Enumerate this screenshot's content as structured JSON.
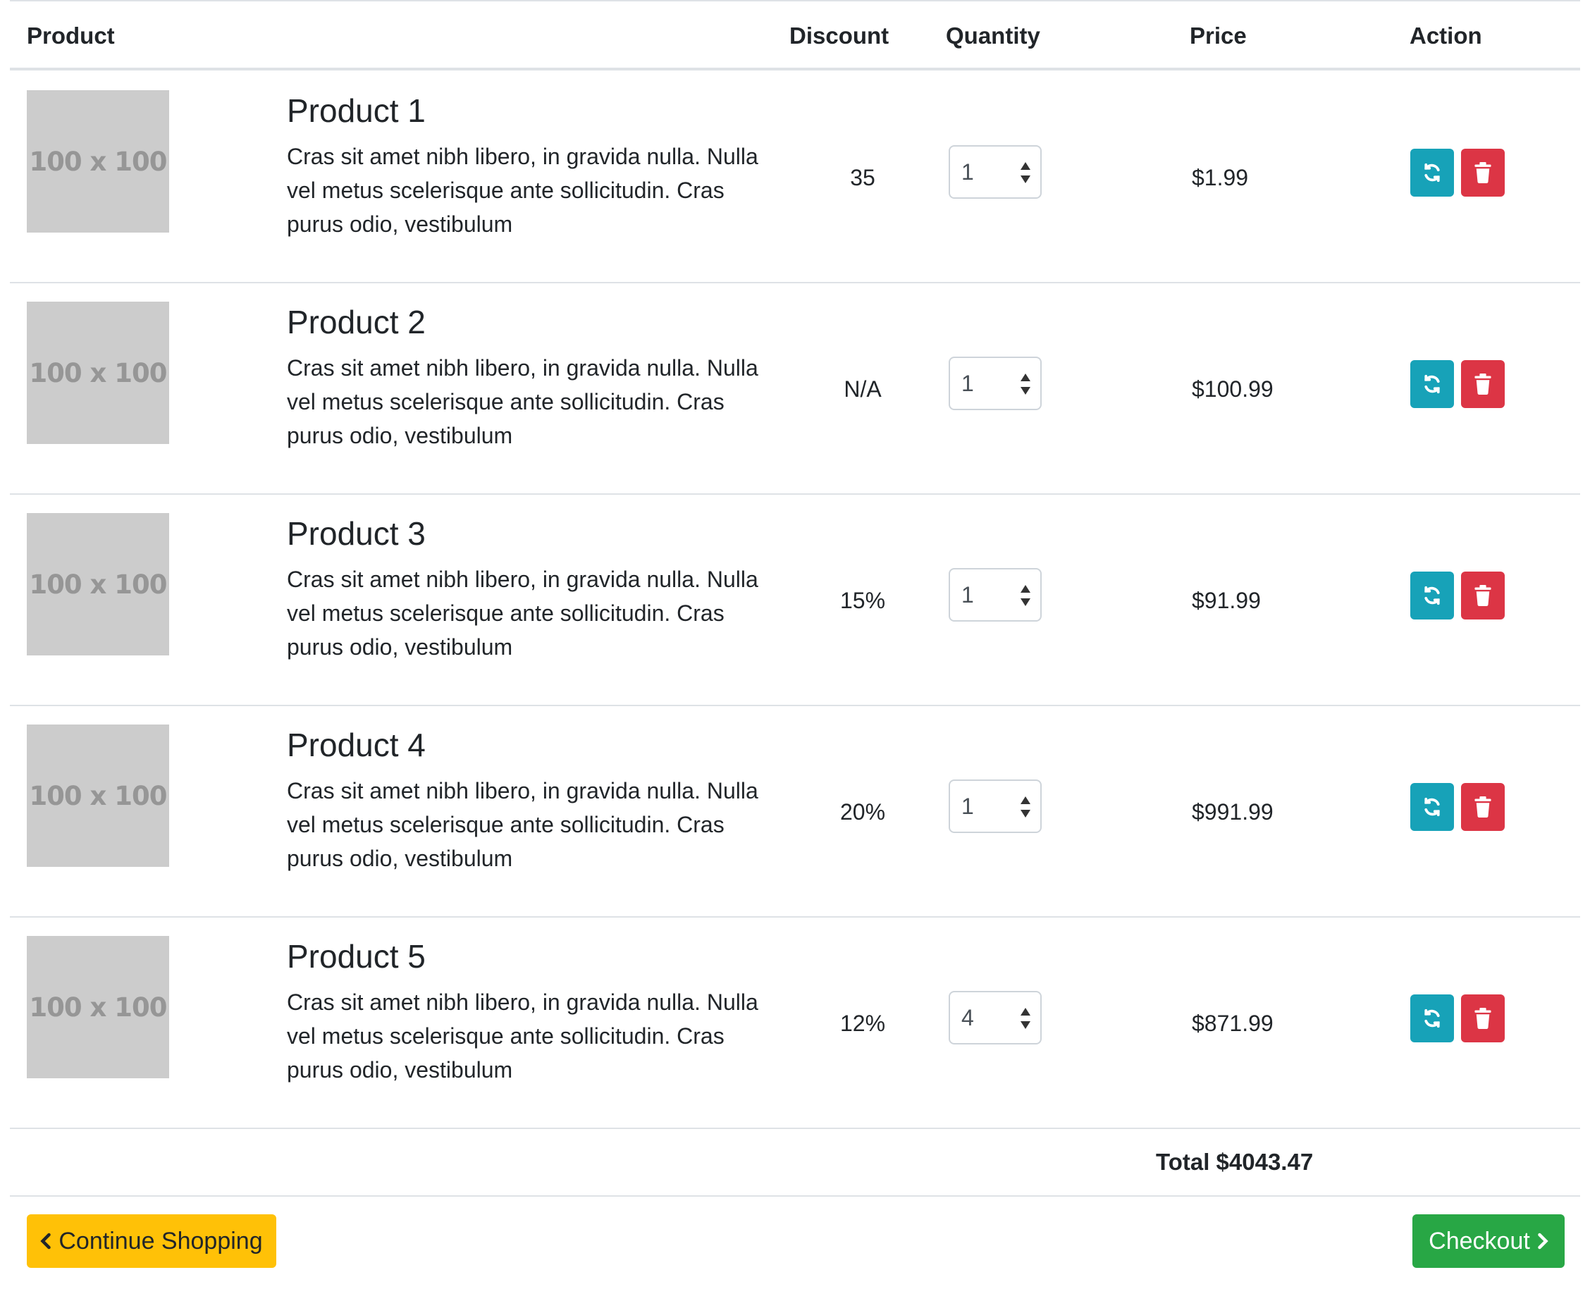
{
  "table": {
    "headers": {
      "product": "Product",
      "discount": "Discount",
      "quantity": "Quantity",
      "price": "Price",
      "action": "Action"
    },
    "rows": [
      {
        "thumb_text": "100 x 100",
        "name": "Product 1",
        "description": "Cras sit amet nibh libero, in gravida nulla. Nulla vel metus scelerisque ante sollicitudin. Cras purus odio, vestibulum",
        "discount": "35",
        "quantity": "1",
        "price": "$1.99"
      },
      {
        "thumb_text": "100 x 100",
        "name": "Product 2",
        "description": "Cras sit amet nibh libero, in gravida nulla. Nulla vel metus scelerisque ante sollicitudin. Cras purus odio, vestibulum",
        "discount": "N/A",
        "quantity": "1",
        "price": "$100.99"
      },
      {
        "thumb_text": "100 x 100",
        "name": "Product 3",
        "description": "Cras sit amet nibh libero, in gravida nulla. Nulla vel metus scelerisque ante sollicitudin. Cras purus odio, vestibulum",
        "discount": "15%",
        "quantity": "1",
        "price": "$91.99"
      },
      {
        "thumb_text": "100 x 100",
        "name": "Product 4",
        "description": "Cras sit amet nibh libero, in gravida nulla. Nulla vel metus scelerisque ante sollicitudin. Cras purus odio, vestibulum",
        "discount": "20%",
        "quantity": "1",
        "price": "$991.99"
      },
      {
        "thumb_text": "100 x 100",
        "name": "Product 5",
        "description": "Cras sit amet nibh libero, in gravida nulla. Nulla vel metus scelerisque ante sollicitudin. Cras purus odio, vestibulum",
        "discount": "12%",
        "quantity": "4",
        "price": "$871.99"
      }
    ],
    "total": "Total $4043.47"
  },
  "actions": {
    "refresh_icon": "refresh-icon",
    "delete_icon": "trash-icon"
  },
  "footer": {
    "continue_label": "Continue Shopping",
    "checkout_label": "Checkout"
  },
  "colors": {
    "refresh_button": "#17a2b8",
    "delete_button": "#dc3545",
    "continue_button": "#ffc107",
    "checkout_button": "#28a745"
  }
}
